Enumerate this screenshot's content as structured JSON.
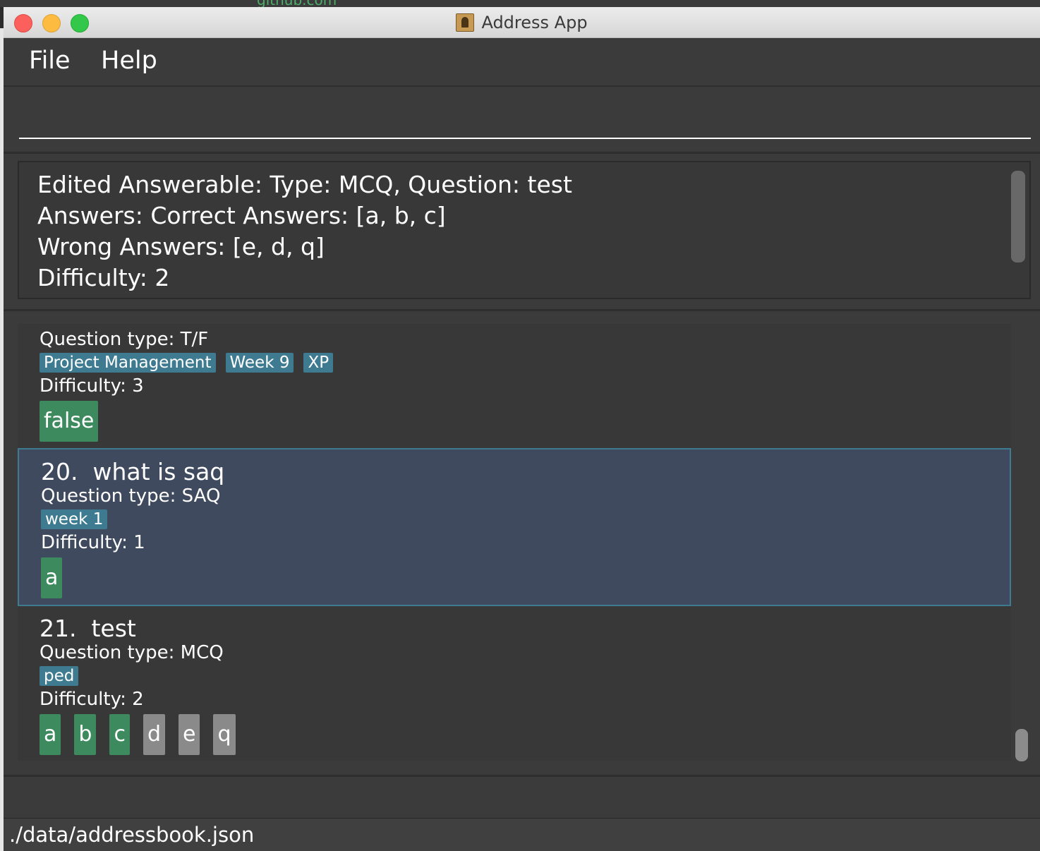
{
  "background": {
    "url_fragment": "github.com"
  },
  "window": {
    "title": "Address App"
  },
  "menu": {
    "file": "File",
    "help": "Help"
  },
  "command": {
    "value": ""
  },
  "result": {
    "lines": [
      "Edited Answerable: Type: MCQ, Question: test",
      "Answers: Correct Answers: [a, b, c]",
      "Wrong Answers: [e, d, q]",
      "Difficulty: 2"
    ]
  },
  "list": {
    "cards": [
      {
        "question_type": "Question type: T/F",
        "tags": [
          "Project Management",
          "Week 9",
          "XP"
        ],
        "difficulty": "Difficulty: 3",
        "answers": [
          {
            "text": "false",
            "correct": true
          }
        ]
      },
      {
        "index": "20.",
        "question": "what is saq",
        "question_type": "Question type: SAQ",
        "tags": [
          "week 1"
        ],
        "difficulty": "Difficulty: 1",
        "answers": [
          {
            "text": "a",
            "correct": true
          }
        ]
      },
      {
        "index": "21.",
        "question": "test",
        "question_type": "Question type: MCQ",
        "tags": [
          "ped"
        ],
        "difficulty": "Difficulty: 2",
        "answers": [
          {
            "text": "a",
            "correct": true
          },
          {
            "text": "b",
            "correct": true
          },
          {
            "text": "c",
            "correct": true
          },
          {
            "text": "d",
            "correct": false
          },
          {
            "text": "e",
            "correct": false
          },
          {
            "text": "q",
            "correct": false
          }
        ]
      }
    ]
  },
  "status": {
    "path": "./data/addressbook.json"
  },
  "colors": {
    "tag": "#3e7b91",
    "correct_answer": "#3d8a5e",
    "wrong_answer": "#8a8a8a",
    "selected_card": "#3f4a5e"
  }
}
